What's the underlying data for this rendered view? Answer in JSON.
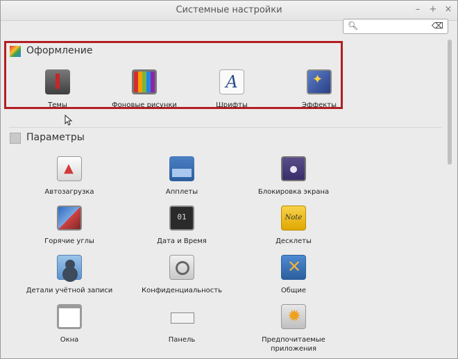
{
  "window": {
    "title": "Системные настройки",
    "minimize": "–",
    "maximize": "+",
    "close": "×"
  },
  "search": {
    "value": "",
    "placeholder": ""
  },
  "sections": {
    "appearance": {
      "title": "Оформление",
      "items": [
        "Темы",
        "Фоновые рисунки",
        "Шрифты",
        "Эффекты"
      ]
    },
    "preferences": {
      "title": "Параметры",
      "items": [
        "Автозагрузка",
        "Апплеты",
        "Блокировка экрана",
        "Горячие углы",
        "Дата и Время",
        "Десклеты",
        "Детали учётной записи",
        "Конфиденциальность",
        "Общие",
        "Окна",
        "Панель",
        "Предпочитаемые приложения"
      ]
    }
  },
  "icon_text": {
    "date_day": "01",
    "desklets": "Note"
  },
  "colors": {
    "highlight": "#b11e22"
  }
}
